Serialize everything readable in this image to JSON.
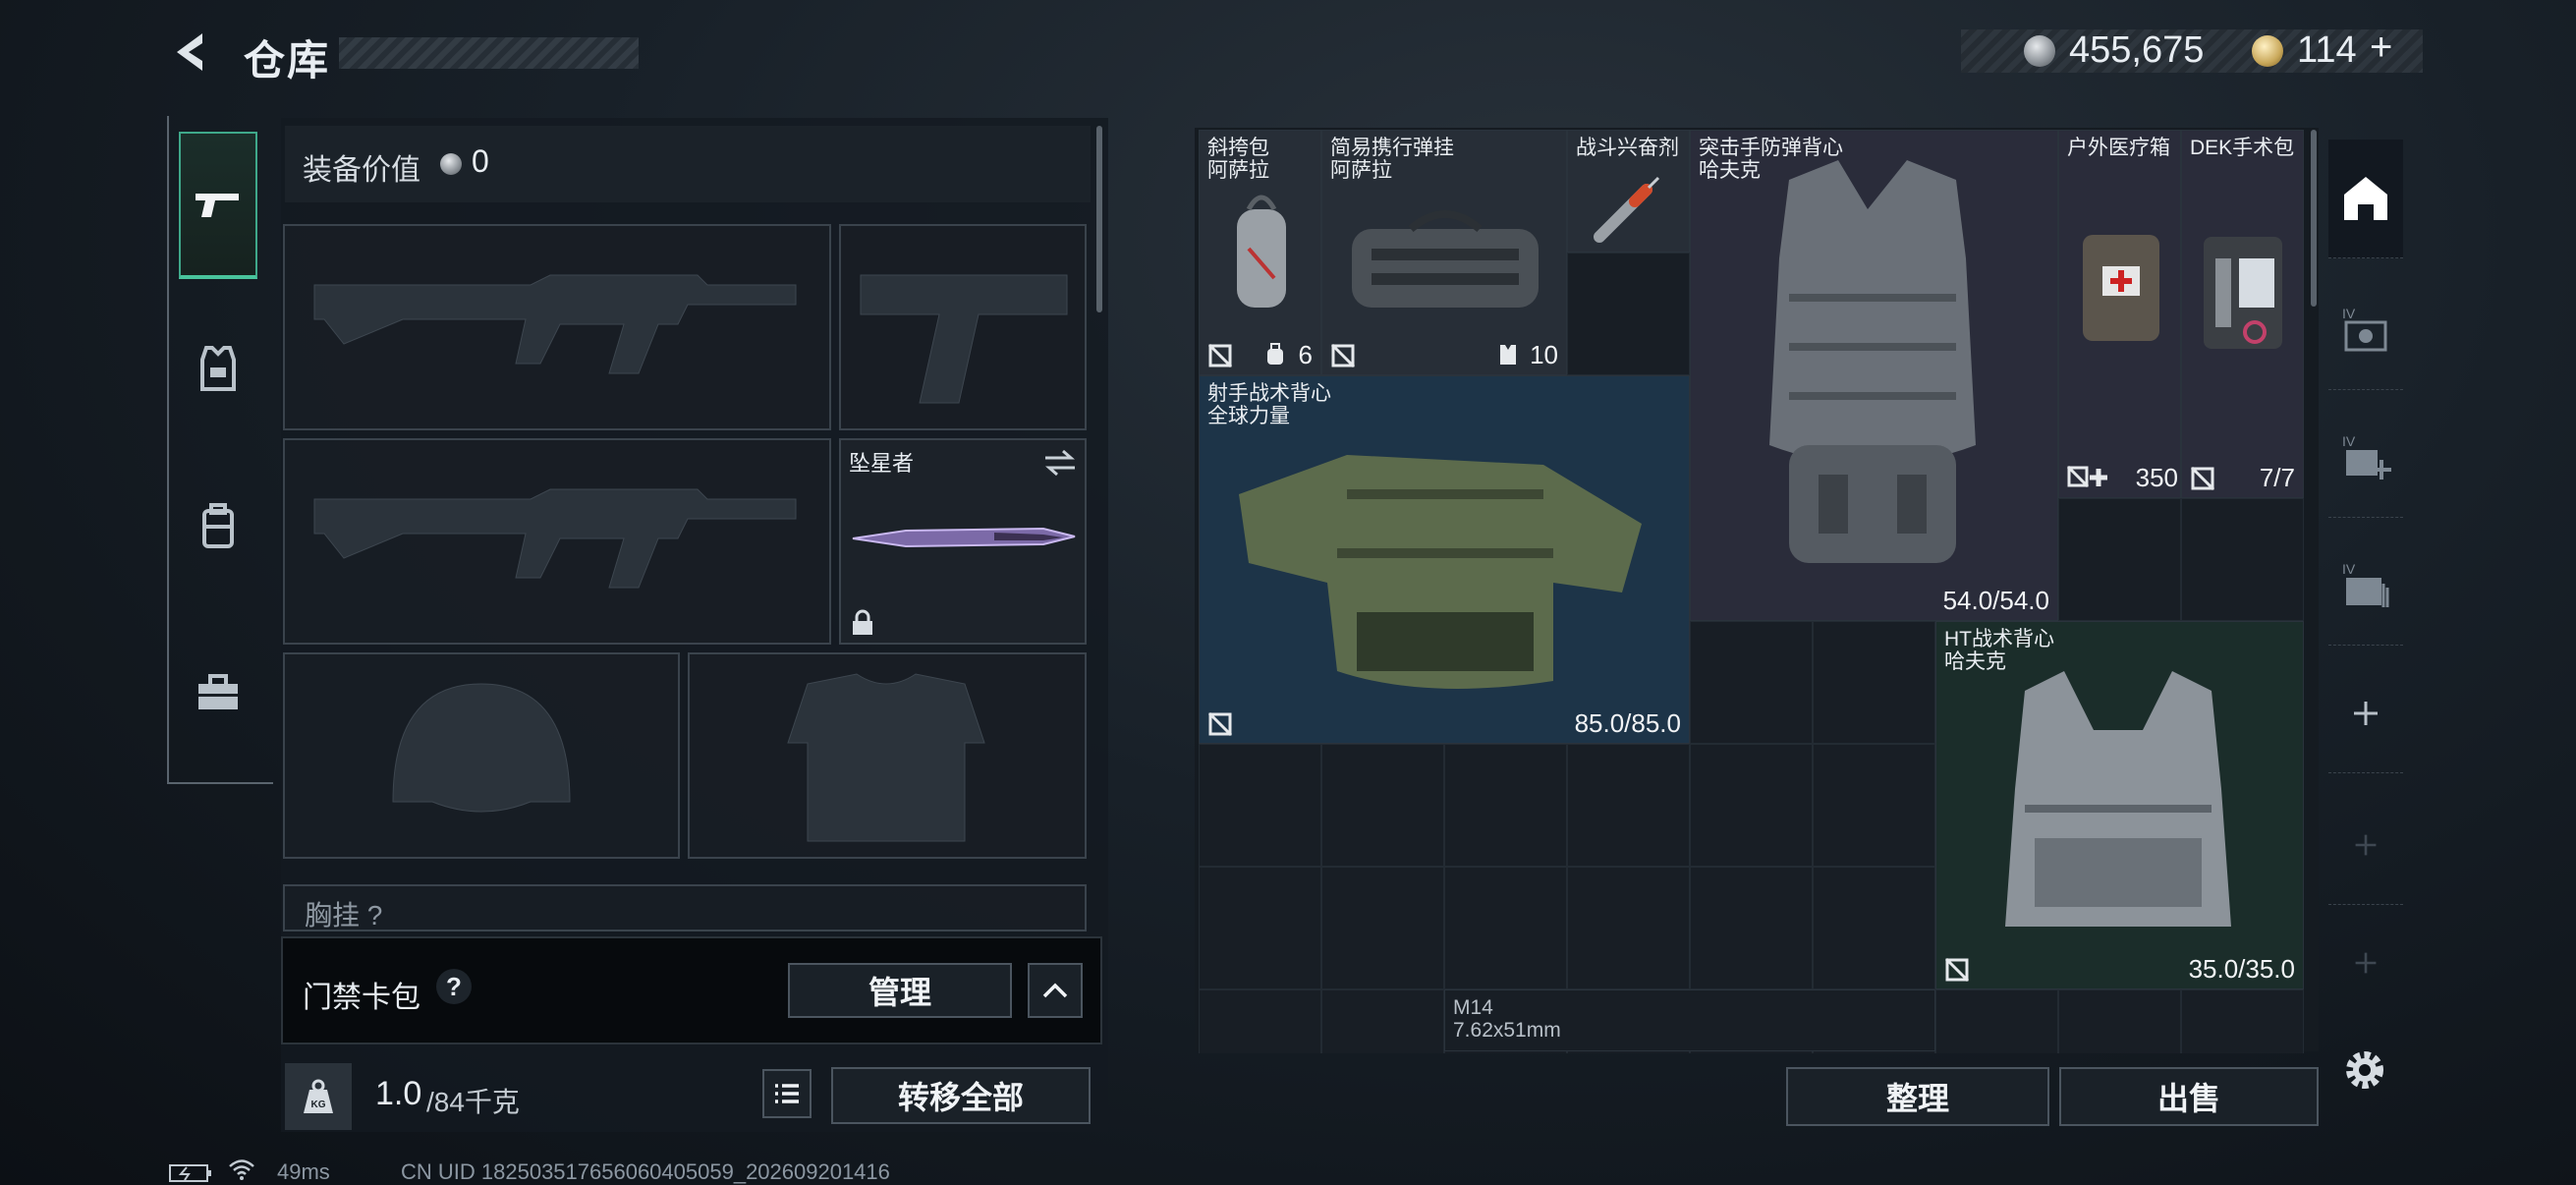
{
  "header": {
    "title": "仓库"
  },
  "currency": {
    "silver": "455,675",
    "gold": "114",
    "gold_plus": "+"
  },
  "equipment": {
    "value_label": "装备价值",
    "value": "0",
    "melee_name": "坠星者",
    "partial_label": "胸挂 ?"
  },
  "keycard": {
    "label": "门禁卡包",
    "help": "?",
    "manage_button": "管理"
  },
  "weight": {
    "current": "1.0",
    "max": "/84千克"
  },
  "transfer_all_button": "转移全部",
  "stash": {
    "items": [
      {
        "name": "斜挎包\n阿萨拉",
        "value": "6"
      },
      {
        "name": "简易携行弹挂\n阿萨拉",
        "value": "10"
      },
      {
        "name": "战斗兴奋剂",
        "value": ""
      },
      {
        "name": "突击手防弹背心\n哈夫克",
        "value": "54.0/54.0"
      },
      {
        "name": "户外医疗箱",
        "value": "350"
      },
      {
        "name": "DEK手术包",
        "value": "7/7"
      },
      {
        "name": "射手战术背心\n全球力量",
        "value": "85.0/85.0"
      },
      {
        "name": "HT战术背心\n哈夫克",
        "value": "35.0/35.0"
      },
      {
        "name": "M14\n7.62x51mm",
        "value": ""
      }
    ],
    "sort_button": "整理",
    "sell_button": "出售"
  },
  "status_bar": {
    "ping": "49ms",
    "uid": "CN UID 182503517656060405059_202609201416"
  },
  "colors": {
    "accent": "#49c49c",
    "background": "#0f141a"
  }
}
